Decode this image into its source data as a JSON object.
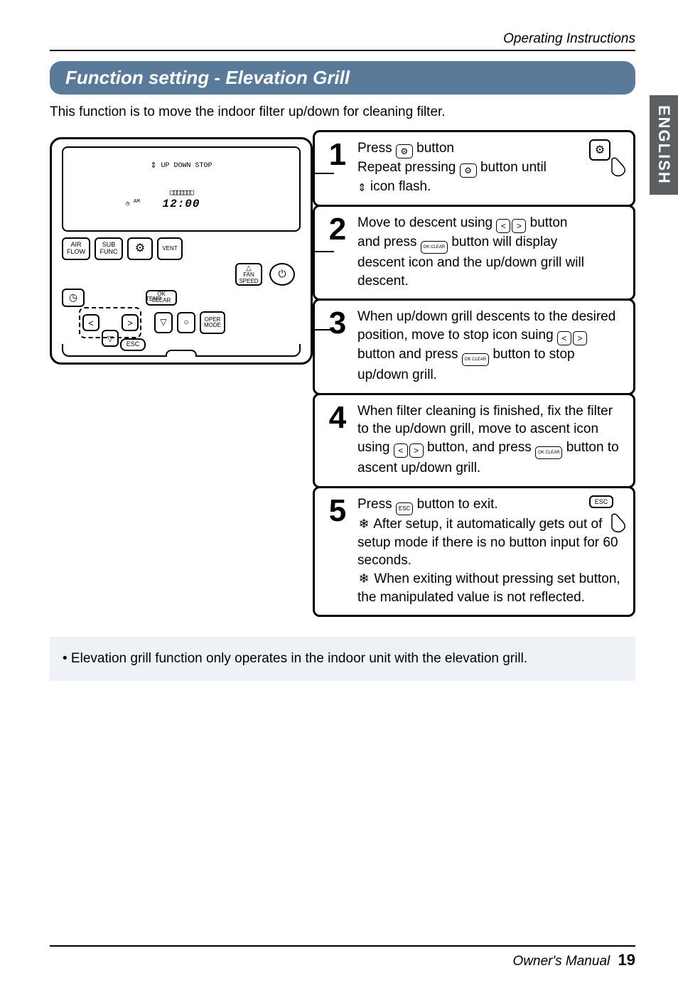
{
  "running_head": "Operating Instructions",
  "title": "Function setting - Elevation Grill",
  "intro": "This function is to move the indoor filter up/down for cleaning filter.",
  "side_tab": "ENGLISH",
  "remote": {
    "lcd_label": "UP DOWN STOP",
    "lcd_clock": "12:00",
    "lcd_ampm": "AM",
    "buttons": {
      "airflow": "AIR\nFLOW",
      "subfunc": "SUB\nFUNC",
      "gear": "⚙",
      "vent": "VENT",
      "fanspeed": "FAN\nSPEED",
      "power": "⏻",
      "clock": "◷",
      "okclear": "OK\nCLEAR",
      "temp": "TEMP",
      "opermode": "OPER\nMODE",
      "esc": "ESC",
      "up": "△",
      "down": "▽",
      "left": "<",
      "right": ">",
      "circle": "○"
    }
  },
  "steps": {
    "s1": {
      "num": "1",
      "l1a": "Press ",
      "l1b": " button",
      "l2a": "Repeat pressing ",
      "l2b": " button until",
      "l3a": " icon flash.",
      "gear": "⚙",
      "updown": "⇕"
    },
    "s2": {
      "num": "2",
      "l1a": "Move to descent using ",
      "l1b": " button",
      "l2a": "and press ",
      "l2b": " button will display",
      "l3": "descent icon and the up/down grill will descent.",
      "lt": "<",
      "gt": ">",
      "ok": "OK CLEAR"
    },
    "s3": {
      "num": "3",
      "l1": "When up/down grill descents to the desired position, move to stop icon suing ",
      "l2": " button and press ",
      "l3": " button to stop up/down grill.",
      "lt": "<",
      "gt": ">",
      "ok": "OK CLEAR"
    },
    "s4": {
      "num": "4",
      "l1": "When filter cleaning is finished, fix the filter to the up/down grill, move to ascent icon using ",
      "l2": " button, and press ",
      "l3": " button to ascent up/down grill.",
      "lt": "<",
      "gt": ">",
      "ok": "OK CLEAR"
    },
    "s5": {
      "num": "5",
      "l1a": "Press ",
      "l1b": " button to exit.",
      "esc": "ESC",
      "b1": "After setup, it automatically gets out of setup mode if there is no button input for 60 seconds.",
      "b2": "When exiting without pressing set button, the manipulated value is not reflected.",
      "star": "❄"
    }
  },
  "note": "• Elevation grill function only operates in the indoor unit with the elevation grill.",
  "footer": {
    "label": "Owner's Manual",
    "page": "19"
  }
}
